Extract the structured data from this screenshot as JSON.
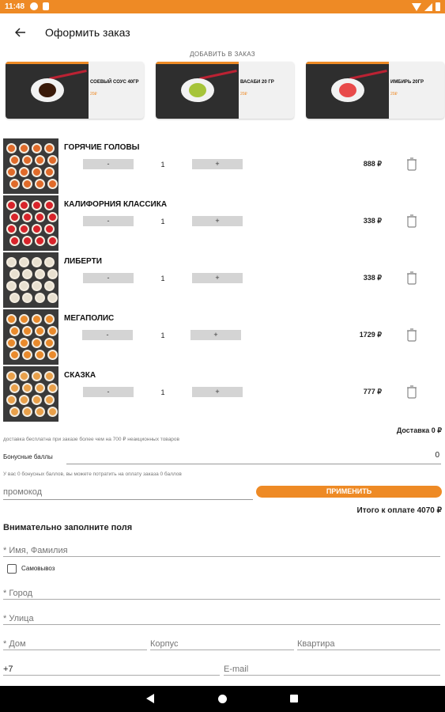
{
  "status_bar": {
    "time": "11:48"
  },
  "app_bar": {
    "title": "Оформить заказ"
  },
  "addons": {
    "caption": "ДОБАВИТЬ В ЗАКАЗ",
    "items": [
      {
        "name": "СОЕВЫЙ СОУС 40ГР",
        "price": "20₽",
        "sauce_color": "#3a1a0a"
      },
      {
        "name": "ВАСАБИ 20 ГР",
        "price": "20₽",
        "sauce_color": "#a6c43a"
      },
      {
        "name": "ИМБИРЬ 20ГР",
        "price": "20₽",
        "sauce_color": "#e84a4a"
      }
    ]
  },
  "cart": {
    "minus_label": "-",
    "plus_label": "+",
    "items": [
      {
        "name": "ГОРЯЧИЕ ГОЛОВЫ",
        "qty": "1",
        "price": "888 ₽",
        "roll_color": "#e06b2a"
      },
      {
        "name": "КАЛИФОРНИЯ КЛАССИКА",
        "qty": "1",
        "price": "338 ₽",
        "roll_color": "#d8232a"
      },
      {
        "name": "ЛИБЕРТИ",
        "qty": "1",
        "price": "338 ₽",
        "roll_color": "#e8e0d0"
      },
      {
        "name": "МЕГАПОЛИС",
        "qty": "1",
        "price": "1729 ₽",
        "roll_color": "#e98a2c"
      },
      {
        "name": "СКАЗКА",
        "qty": "1",
        "price": "777 ₽",
        "roll_color": "#e9a04a"
      }
    ]
  },
  "summary": {
    "delivery": "Доставка 0 ₽",
    "delivery_note": "доставка бесплатна при заказе более чем на 700 ₽ неакционных товаров",
    "bonus_label": "Бонусные баллы",
    "bonus_value": "0",
    "bonus_note": "У вас 0 бонусных баллов, вы можете потратить на оплату заказа 0 баллов",
    "promo_placeholder": "промокод",
    "apply_label": "ПРИМЕНИТЬ",
    "total": "Итого к оплате 4070 ₽"
  },
  "form": {
    "title": "Внимательно заполните поля",
    "name_placeholder": "* Имя, Фамилия",
    "pickup_label": "Самовывоз",
    "city_placeholder": "* Город",
    "street_placeholder": "* Улица",
    "house_placeholder": "* Дом",
    "building_placeholder": "Корпус",
    "apartment_placeholder": "Квартира",
    "phone_value": "+7",
    "email_placeholder": "E-mail"
  },
  "colors": {
    "accent": "#ee8a25"
  }
}
